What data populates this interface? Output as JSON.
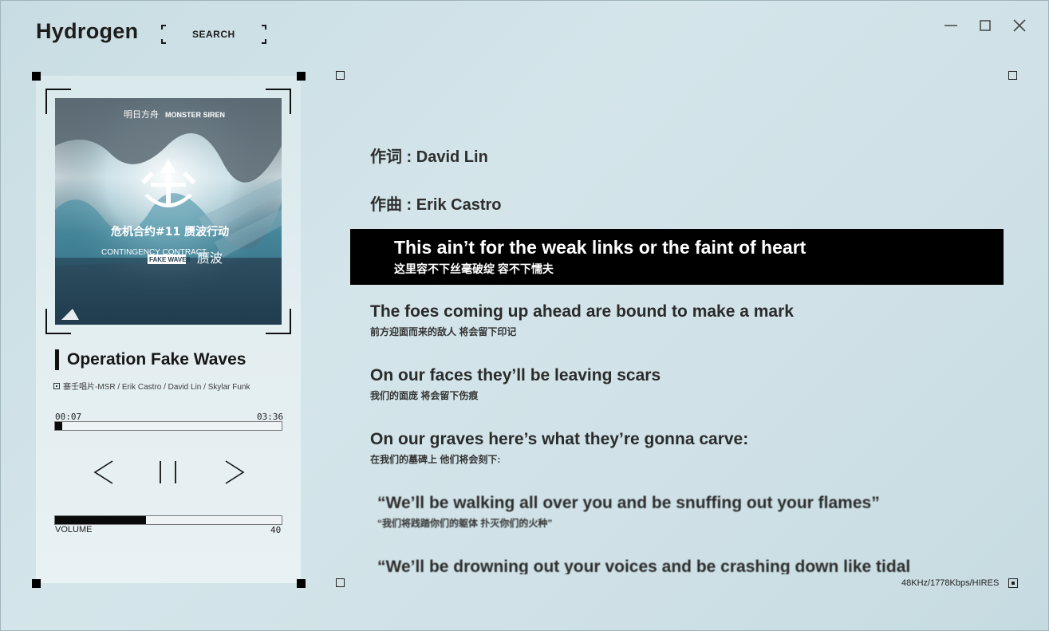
{
  "app": {
    "title": "Hydrogen"
  },
  "search": {
    "label": "SEARCH"
  },
  "window_controls": {
    "minimize_icon": "minimize-icon",
    "maximize_icon": "maximize-icon",
    "close_icon": "close-icon"
  },
  "player": {
    "title": "Operation Fake Waves",
    "artists": "塞壬唱片-MSR / Erik Castro / David Lin / Skylar Funk",
    "album_art_texts": {
      "logo_left": "明日方舟",
      "logo_right": "MONSTER SIREN",
      "event_title": "危机合约#11  赝波行动",
      "subtitle_en": "CONTINGENCY CONTRACT",
      "operation_name": "FAKE WAVES",
      "operation_cn": "赝波"
    },
    "time_current": "00:07",
    "time_total": "03:36",
    "progress": 0.032,
    "volume_label": "VOLUME",
    "volume_value": "40",
    "volume": 0.4,
    "controls": {
      "prev_icon": "chevron-left-icon",
      "pause_icon": "pause-icon",
      "next_icon": "chevron-right-icon"
    }
  },
  "lyrics": {
    "lyricist": "作词 : David Lin",
    "composer": "作曲 : Erik Castro",
    "active": {
      "en": "This ain’t for the weak links or the faint of heart",
      "zh": "这里容不下丝毫破绽 容不下懦夫"
    },
    "lines": [
      {
        "en": "The foes coming up ahead are bound to make a mark",
        "zh": "前方迎面而来的敌人 将会留下印记"
      },
      {
        "en": "On our faces they’ll be leaving scars",
        "zh": "我们的面庞 将会留下伤痕"
      },
      {
        "en": "On our graves here’s what they’re gonna carve:",
        "zh": "在我们的墓碑上 他们将会刻下:"
      },
      {
        "en": "“We’ll be walking all over you and be snuffing out your flames”",
        "zh": "“我们将践踏你们的躯体 扑灭你们的火种”"
      },
      {
        "en": "“We’ll be drowning out your voices and be crashing down like tidal",
        "zh": ""
      }
    ]
  },
  "status": {
    "audio_info": "48KHz/1778Kbps/HIRES"
  }
}
